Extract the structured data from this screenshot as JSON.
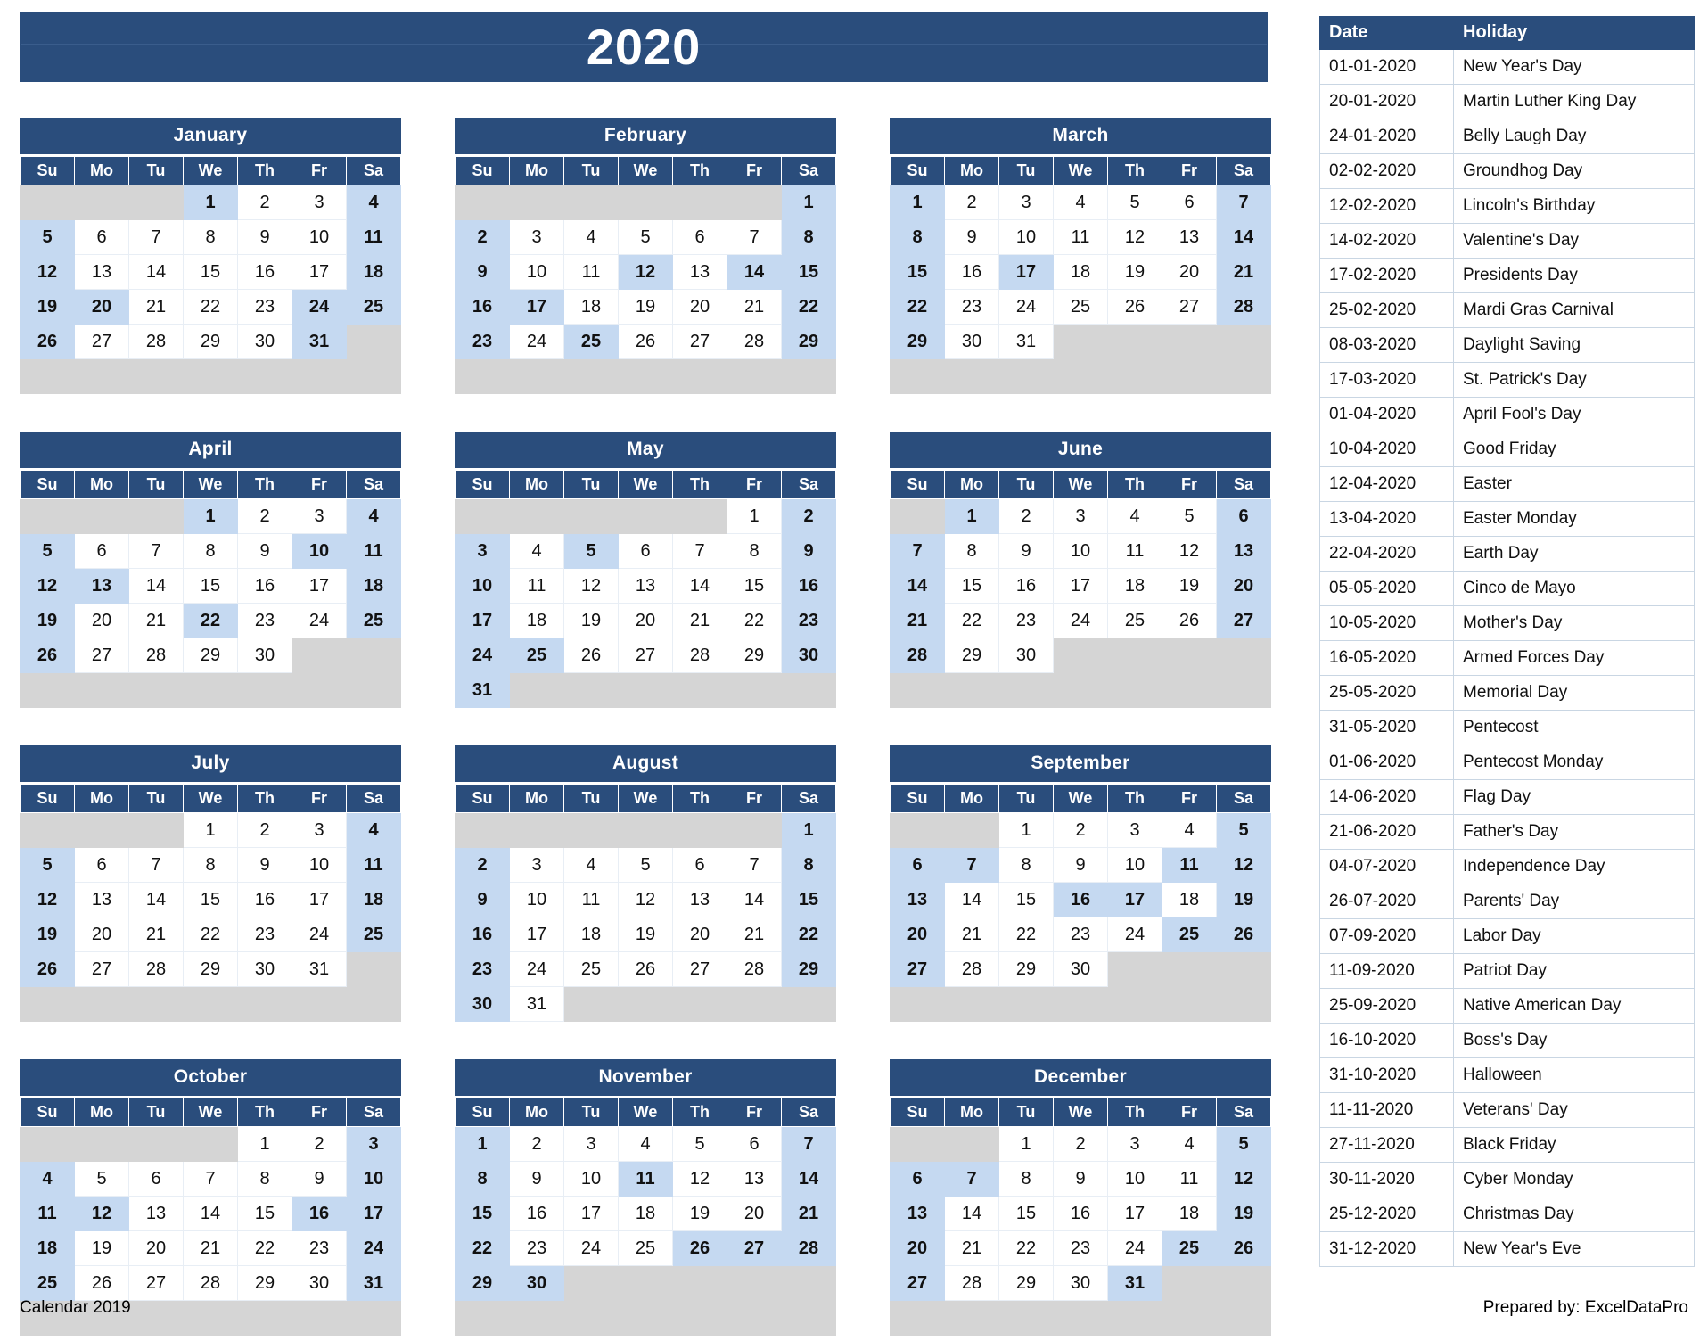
{
  "year_title": "2020",
  "footer": {
    "left": "Calendar 2019",
    "right": "Prepared by: ExcelDataPro"
  },
  "weekday_headers": [
    "Su",
    "Mo",
    "Tu",
    "We",
    "Th",
    "Fr",
    "Sa"
  ],
  "colors": {
    "header_blue": "#2a4d7c",
    "highlight_blue": "#c5d9f1",
    "pad_gray": "#d5d5d5",
    "cell_white": "#ffffff",
    "grid_line": "#c9d6e3"
  },
  "months": [
    {
      "name": "January",
      "lead_blanks": 3,
      "days": 31,
      "highlighted": [
        1,
        4,
        5,
        11,
        12,
        18,
        19,
        20,
        24,
        25,
        26,
        31
      ]
    },
    {
      "name": "February",
      "lead_blanks": 6,
      "days": 29,
      "highlighted": [
        1,
        2,
        8,
        9,
        12,
        14,
        15,
        16,
        17,
        22,
        23,
        25,
        29
      ]
    },
    {
      "name": "March",
      "lead_blanks": 0,
      "days": 31,
      "highlighted": [
        1,
        7,
        8,
        14,
        15,
        17,
        21,
        22,
        28,
        29
      ]
    },
    {
      "name": "April",
      "lead_blanks": 3,
      "days": 30,
      "highlighted": [
        1,
        4,
        5,
        10,
        11,
        12,
        13,
        18,
        19,
        22,
        25,
        26
      ]
    },
    {
      "name": "May",
      "lead_blanks": 5,
      "days": 31,
      "highlighted": [
        2,
        3,
        5,
        9,
        10,
        16,
        17,
        23,
        24,
        25,
        30,
        31
      ]
    },
    {
      "name": "June",
      "lead_blanks": 1,
      "days": 30,
      "highlighted": [
        1,
        6,
        7,
        13,
        14,
        20,
        21,
        27,
        28
      ]
    },
    {
      "name": "July",
      "lead_blanks": 3,
      "days": 31,
      "highlighted": [
        4,
        5,
        11,
        12,
        18,
        19,
        25,
        26
      ]
    },
    {
      "name": "August",
      "lead_blanks": 6,
      "days": 31,
      "highlighted": [
        1,
        2,
        8,
        9,
        15,
        16,
        22,
        23,
        29,
        30
      ]
    },
    {
      "name": "September",
      "lead_blanks": 2,
      "days": 30,
      "highlighted": [
        5,
        6,
        7,
        11,
        12,
        13,
        16,
        17,
        19,
        20,
        25,
        26,
        27
      ]
    },
    {
      "name": "October",
      "lead_blanks": 4,
      "days": 31,
      "highlighted": [
        3,
        4,
        10,
        11,
        12,
        16,
        17,
        18,
        24,
        25,
        31
      ]
    },
    {
      "name": "November",
      "lead_blanks": 0,
      "days": 30,
      "highlighted": [
        1,
        7,
        8,
        11,
        14,
        15,
        21,
        22,
        26,
        27,
        28,
        29,
        30
      ]
    },
    {
      "name": "December",
      "lead_blanks": 2,
      "days": 31,
      "highlighted": [
        5,
        6,
        7,
        12,
        13,
        19,
        20,
        25,
        26,
        27,
        31
      ]
    }
  ],
  "holiday_table": {
    "columns": [
      "Date",
      "Holiday"
    ],
    "rows": [
      {
        "date": "01-01-2020",
        "holiday": "New Year's Day"
      },
      {
        "date": "20-01-2020",
        "holiday": "Martin Luther King Day"
      },
      {
        "date": "24-01-2020",
        "holiday": "Belly Laugh Day"
      },
      {
        "date": "02-02-2020",
        "holiday": "Groundhog Day"
      },
      {
        "date": "12-02-2020",
        "holiday": "Lincoln's Birthday"
      },
      {
        "date": "14-02-2020",
        "holiday": "Valentine's Day"
      },
      {
        "date": "17-02-2020",
        "holiday": "Presidents Day"
      },
      {
        "date": "25-02-2020",
        "holiday": "Mardi Gras Carnival"
      },
      {
        "date": "08-03-2020",
        "holiday": "Daylight Saving"
      },
      {
        "date": "17-03-2020",
        "holiday": "St. Patrick's Day"
      },
      {
        "date": "01-04-2020",
        "holiday": "April Fool's Day"
      },
      {
        "date": "10-04-2020",
        "holiday": "Good Friday"
      },
      {
        "date": "12-04-2020",
        "holiday": "Easter"
      },
      {
        "date": "13-04-2020",
        "holiday": "Easter Monday"
      },
      {
        "date": "22-04-2020",
        "holiday": "Earth Day"
      },
      {
        "date": "05-05-2020",
        "holiday": "Cinco de Mayo"
      },
      {
        "date": "10-05-2020",
        "holiday": "Mother's Day"
      },
      {
        "date": "16-05-2020",
        "holiday": "Armed Forces Day"
      },
      {
        "date": "25-05-2020",
        "holiday": "Memorial Day"
      },
      {
        "date": "31-05-2020",
        "holiday": "Pentecost"
      },
      {
        "date": "01-06-2020",
        "holiday": "Pentecost Monday"
      },
      {
        "date": "14-06-2020",
        "holiday": "Flag Day"
      },
      {
        "date": "21-06-2020",
        "holiday": "Father's Day"
      },
      {
        "date": "04-07-2020",
        "holiday": "Independence Day"
      },
      {
        "date": "26-07-2020",
        "holiday": "Parents' Day"
      },
      {
        "date": "07-09-2020",
        "holiday": "Labor Day"
      },
      {
        "date": "11-09-2020",
        "holiday": "Patriot Day"
      },
      {
        "date": "25-09-2020",
        "holiday": "Native American Day"
      },
      {
        "date": "16-10-2020",
        "holiday": "Boss's Day"
      },
      {
        "date": "31-10-2020",
        "holiday": "Halloween"
      },
      {
        "date": "11-11-2020",
        "holiday": "Veterans' Day"
      },
      {
        "date": "27-11-2020",
        "holiday": "Black Friday"
      },
      {
        "date": "30-11-2020",
        "holiday": "Cyber Monday"
      },
      {
        "date": "25-12-2020",
        "holiday": "Christmas Day"
      },
      {
        "date": "31-12-2020",
        "holiday": "New Year's Eve"
      }
    ]
  }
}
